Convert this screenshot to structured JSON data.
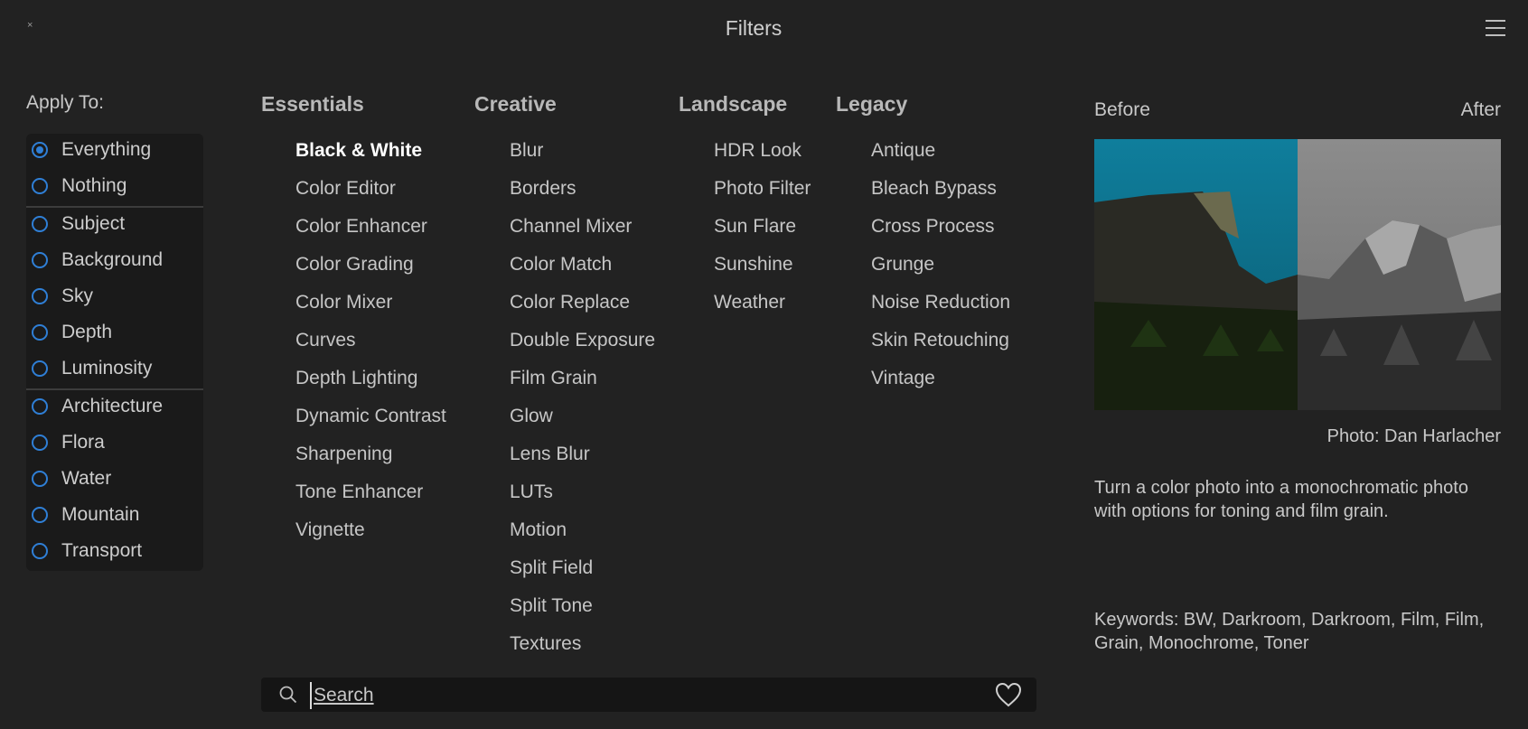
{
  "window": {
    "title": "Filters",
    "close_glyph": "×",
    "menu_icon": "hamburger-menu-icon"
  },
  "apply_to": {
    "label": "Apply To:",
    "items": [
      {
        "label": "Everything",
        "selected": true
      },
      {
        "label": "Nothing",
        "selected": false
      },
      {
        "label": "Subject",
        "selected": false
      },
      {
        "label": "Background",
        "selected": false
      },
      {
        "label": "Sky",
        "selected": false
      },
      {
        "label": "Depth",
        "selected": false
      },
      {
        "label": "Luminosity",
        "selected": false
      },
      {
        "label": "Architecture",
        "selected": false
      },
      {
        "label": "Flora",
        "selected": false
      },
      {
        "label": "Water",
        "selected": false
      },
      {
        "label": "Mountain",
        "selected": false
      },
      {
        "label": "Transport",
        "selected": false
      }
    ]
  },
  "categories": [
    {
      "name": "Essentials",
      "items": [
        "Black & White",
        "Color Editor",
        "Color Enhancer",
        "Color Grading",
        "Color Mixer",
        "Curves",
        "Depth Lighting",
        "Dynamic Contrast",
        "Sharpening",
        "Tone Enhancer",
        "Vignette"
      ]
    },
    {
      "name": "Creative",
      "items": [
        "Blur",
        "Borders",
        "Channel Mixer",
        "Color Match",
        "Color Replace",
        "Double Exposure",
        "Film Grain",
        "Glow",
        "Lens Blur",
        "LUTs",
        "Motion",
        "Split Field",
        "Split Tone",
        "Textures"
      ]
    },
    {
      "name": "Landscape",
      "items": [
        "HDR Look",
        "Photo Filter",
        "Sun Flare",
        "Sunshine",
        "Weather"
      ]
    },
    {
      "name": "Legacy",
      "items": [
        "Antique",
        "Bleach Bypass",
        "Cross Process",
        "Grunge",
        "Noise Reduction",
        "Skin Retouching",
        "Vintage"
      ]
    }
  ],
  "selected_filter": "Black & White",
  "preview": {
    "before_label": "Before",
    "after_label": "After",
    "credit": "Photo: Dan Harlacher",
    "description": "Turn a color photo into a monochromatic photo with options for toning and film grain.",
    "keywords": "Keywords: BW, Darkroom, Darkroom, Film, Film, Grain, Monochrome, Toner"
  },
  "search": {
    "placeholder": "Search",
    "value": ""
  },
  "colors": {
    "background": "#222222",
    "panel": "#1a1a1a",
    "accent": "#2f7fd6",
    "search_bg": "#151515"
  }
}
